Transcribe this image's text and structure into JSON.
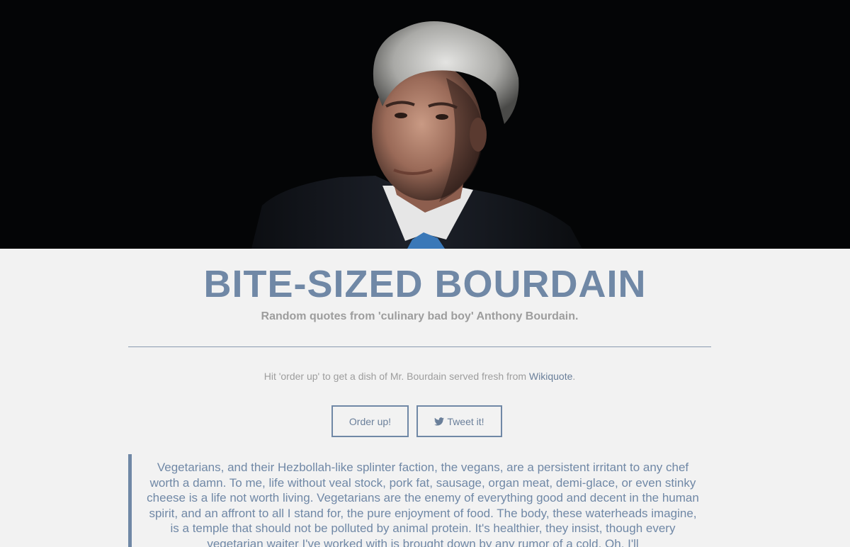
{
  "hero": {
    "photo_icon": "portrait-photo"
  },
  "header": {
    "title": "BITE-SIZED BOURDAIN",
    "subtitle": "Random quotes from 'culinary bad boy' Anthony Bourdain."
  },
  "intro": {
    "text_before": "Hit 'order up' to get a dish of Mr. Bourdain served fresh from ",
    "link_text": "Wikiquote",
    "text_after": "."
  },
  "buttons": {
    "order_label": "Order up!",
    "tweet_label": "Tweet it!",
    "tweet_icon": "twitter-bird-icon"
  },
  "quote": {
    "text": "Vegetarians, and their Hezbollah-like splinter faction, the vegans, are a persistent irritant to any chef worth a damn. To me, life without veal stock, pork fat, sausage, organ meat, demi-glace, or even stinky cheese is a life not worth living. Vegetarians are the enemy of everything good and decent in the human spirit, and an affront to all I stand for, the pure enjoyment of food. The body, these waterheads imagine, is a temple that should not be polluted by animal protein. It's healthier, they insist, though every vegetarian waiter I've worked with is brought down by any rumor of a cold. Oh, I'll"
  },
  "colors": {
    "accent": "#7088a6",
    "background": "#f2f2f2",
    "muted_text": "#9d9d9d",
    "hero_bg": "#040506"
  }
}
